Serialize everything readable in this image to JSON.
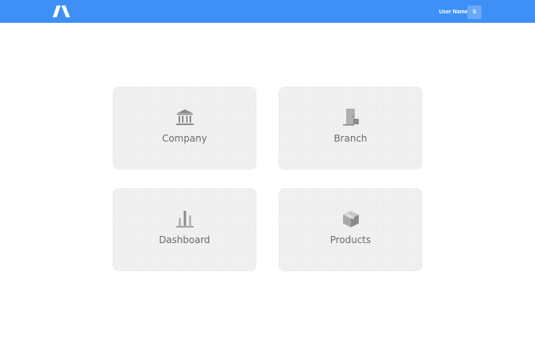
{
  "header": {
    "logo_icon": "brand-logo",
    "user_name": "User Name",
    "avatar_initial": "S",
    "background_color": "#3f90f6"
  },
  "cards": [
    {
      "label": "Company",
      "icon": "bank-icon"
    },
    {
      "label": "Branch",
      "icon": "door-icon"
    },
    {
      "label": "Dashboard",
      "icon": "bar-chart-icon"
    },
    {
      "label": "Products",
      "icon": "box-icon"
    }
  ]
}
